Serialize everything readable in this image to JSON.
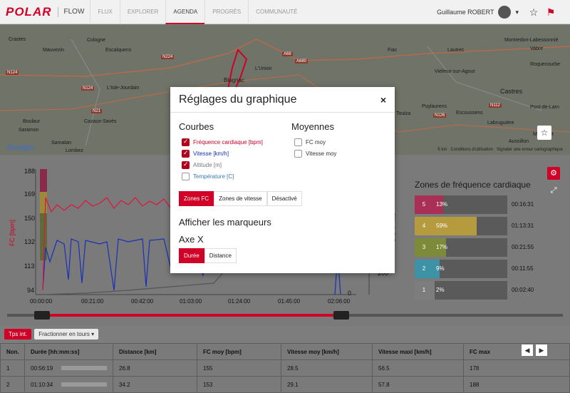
{
  "header": {
    "logo": "POLAR",
    "app": "FLOW",
    "nav": [
      "FLUX",
      "EXPLORER",
      "AGENDA",
      "PROGRÈS",
      "COMMUNAUTÉ"
    ],
    "active_nav": "AGENDA",
    "user_name": "Guillaume ROBERT",
    "chevron": "▾",
    "star_icon": "☆",
    "notif_icon": "⚑"
  },
  "map": {
    "labels": [
      {
        "t": "Crastes"
      },
      {
        "t": "Cologne"
      },
      {
        "t": "Mauvezin"
      },
      {
        "t": "Escalquens"
      },
      {
        "t": "Blagnac"
      },
      {
        "t": "L'Union"
      },
      {
        "t": "L'Isle-Jourdain"
      },
      {
        "t": "Castres"
      },
      {
        "t": "Boulaur"
      },
      {
        "t": "Saramon"
      },
      {
        "t": "Cazaux-Savès"
      },
      {
        "t": "Samatan"
      },
      {
        "t": "Lombez"
      },
      {
        "t": "Toulza"
      },
      {
        "t": "Puylaurens"
      },
      {
        "t": "Labruguière"
      },
      {
        "t": "Montredon-Labessonnié"
      },
      {
        "t": "Lautrec"
      },
      {
        "t": "Roquecourbe"
      },
      {
        "t": "Fiac"
      },
      {
        "t": "Vielmur-sur-Agout"
      },
      {
        "t": "Escoussens"
      },
      {
        "t": "Pont-de-Larn"
      },
      {
        "t": "Vabre"
      },
      {
        "t": "Aussillon"
      },
      {
        "t": "Mazamet"
      }
    ],
    "road_badges": [
      "N124",
      "N124",
      "N224",
      "A68",
      "A680",
      "N126",
      "N112",
      "N21"
    ],
    "google": "Google",
    "scale": "5 km",
    "terms": "Conditions d'utilisation",
    "report": "Signaler une erreur cartographique"
  },
  "chart": {
    "ylabel": "FC [bpm]",
    "yticks": [
      "188",
      "169",
      "150",
      "132",
      "113",
      "94"
    ],
    "y2label": "Altitude [m]",
    "y2ticks": [
      "200"
    ],
    "xticks": [
      "00:00:00",
      "00:21:00",
      "00:42:00",
      "01:03:00",
      "01:24:00",
      "01:45:00",
      "02:06:00"
    ],
    "y_right_end": "0",
    "colors": {
      "hr": "#e0143c",
      "speed": "#1631b8",
      "alt": "#555555"
    }
  },
  "chart_data": {
    "type": "line",
    "title": "",
    "xlabel": "",
    "ylabel": "FC [bpm]",
    "ylim": [
      94,
      188
    ],
    "x": [
      "00:00:00",
      "00:21:00",
      "00:42:00",
      "01:03:00",
      "01:24:00",
      "01:45:00",
      "02:06:00"
    ],
    "series": []
  },
  "zones": {
    "title": "Zones de fréquence cardiaque",
    "rows": [
      {
        "num": "5",
        "pct": "13%",
        "time": "00:16:31",
        "frac": 0.13,
        "color": "#a83057"
      },
      {
        "num": "4",
        "pct": "59%",
        "time": "01:13:31",
        "frac": 0.59,
        "color": "#b59a3e"
      },
      {
        "num": "3",
        "pct": "17%",
        "time": "00:21:55",
        "frac": 0.17,
        "color": "#7d8a3a"
      },
      {
        "num": "2",
        "pct": "9%",
        "time": "00:11:55",
        "frac": 0.09,
        "color": "#3e92a6"
      },
      {
        "num": "1",
        "pct": "2%",
        "time": "00:02:40",
        "frac": 0.02,
        "color": "#7d7d7d"
      }
    ]
  },
  "toolbar": {
    "laps": "Tps int.",
    "split": "Fractionner en tours",
    "split_icon": "▾"
  },
  "table": {
    "headers": [
      "Non.",
      "Durée [hh:mm:ss]",
      "Distance [km]",
      "FC moy [bpm]",
      "Vitesse moy [km/h]",
      "Vitesse maxi [km/h]",
      "FC max"
    ],
    "rows": [
      [
        "1",
        "00:56:19",
        "26.8",
        "155",
        "28.5",
        "56.5",
        "178"
      ],
      [
        "2",
        "01:10:34",
        "34.2",
        "153",
        "29.1",
        "57.8",
        "188"
      ]
    ],
    "prev": "◀",
    "next": "▶"
  },
  "modal": {
    "title": "Réglages du graphique",
    "close": "×",
    "curves_title": "Courbes",
    "curves": [
      {
        "label": "Fréquence cardiaque [bpm]",
        "checked": true,
        "color": "#d10027"
      },
      {
        "label": "Vitesse [km/h]",
        "checked": true,
        "color": "#1631b8"
      },
      {
        "label": "Altitude [m]",
        "checked": true,
        "color": "#777777"
      },
      {
        "label": "Température [C]",
        "checked": false,
        "color": "#3a78b0"
      }
    ],
    "averages_title": "Moyennes",
    "averages": [
      {
        "label": "FC moy",
        "checked": false
      },
      {
        "label": "Vitesse moy",
        "checked": false
      }
    ],
    "zone_options": [
      "Zones FC",
      "Zones de vitesse",
      "Désactivé"
    ],
    "zone_selected": "Zones FC",
    "markers_title": "Afficher les marqueurs",
    "axis_title": "Axe X",
    "axis_options": [
      "Durée",
      "Distance"
    ],
    "axis_selected": "Durée"
  }
}
